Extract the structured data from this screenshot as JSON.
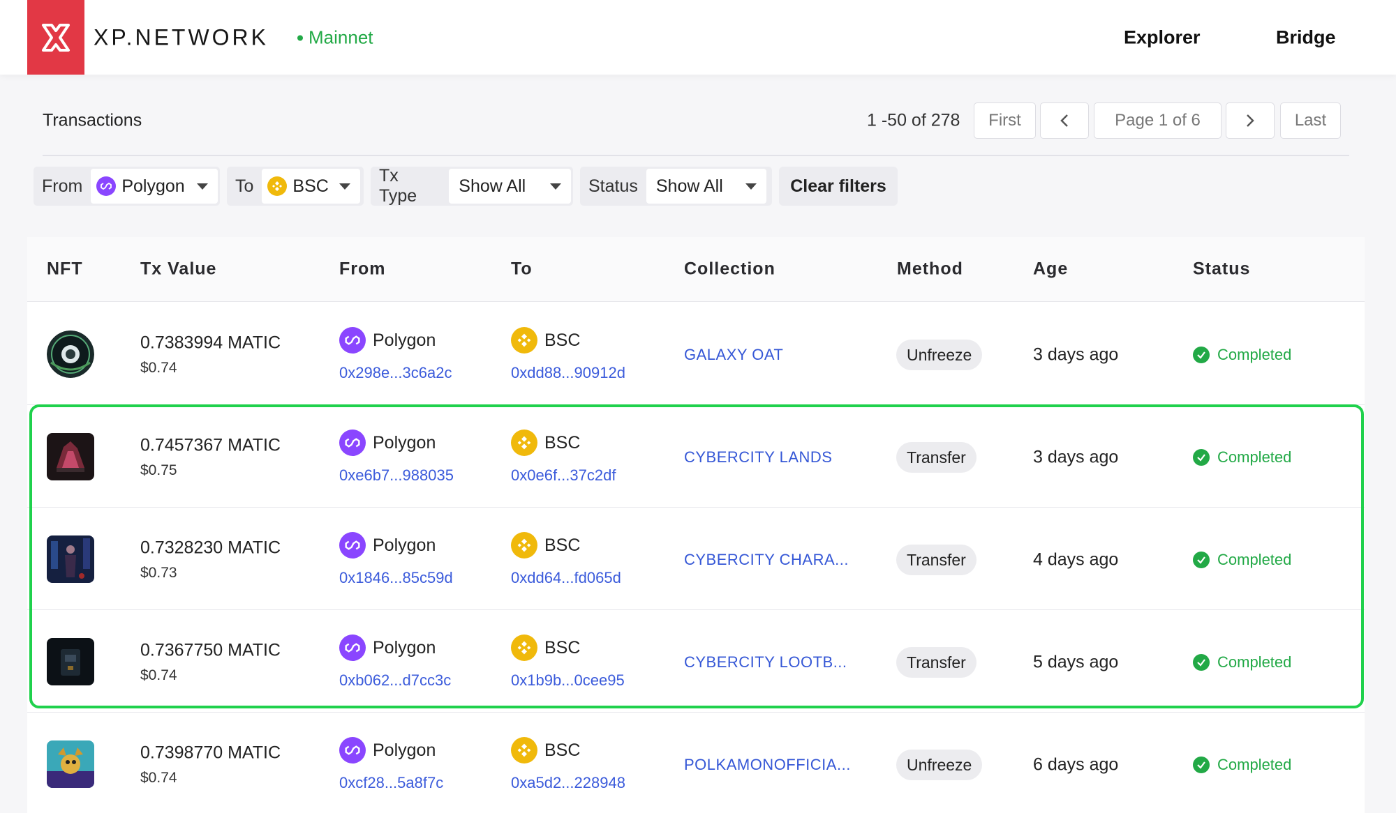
{
  "header": {
    "brand": "XP.NETWORK",
    "network": "Mainnet",
    "nav": [
      "Explorer",
      "Bridge"
    ],
    "accent": "#e23845",
    "network_color": "#22a946"
  },
  "toolbar": {
    "title": "Transactions",
    "range": "1 -50 of 278",
    "first": "First",
    "page": "Page 1 of 6",
    "last": "Last"
  },
  "filters": {
    "from_label": "From",
    "from_value": "Polygon",
    "to_label": "To",
    "to_value": "BSC",
    "txtype_label": "Tx Type",
    "txtype_value": "Show All",
    "status_label": "Status",
    "status_value": "Show All",
    "clear": "Clear filters"
  },
  "table": {
    "columns": [
      "NFT",
      "Tx Value",
      "From",
      "To",
      "Collection",
      "Method",
      "Age",
      "Status"
    ],
    "rows": [
      {
        "value": "0.7383994 MATIC",
        "usd": "$0.74",
        "from_chain": "Polygon",
        "from_addr": "0x298e...3c6a2c",
        "to_chain": "BSC",
        "to_addr": "0xdd88...90912d",
        "collection": "GALAXY OAT",
        "method": "Unfreeze",
        "age": "3 days ago",
        "status": "Completed"
      },
      {
        "value": "0.7457367 MATIC",
        "usd": "$0.75",
        "from_chain": "Polygon",
        "from_addr": "0xe6b7...988035",
        "to_chain": "BSC",
        "to_addr": "0x0e6f...37c2df",
        "collection": "CYBERCITY LANDS",
        "method": "Transfer",
        "age": "3 days ago",
        "status": "Completed"
      },
      {
        "value": "0.7328230 MATIC",
        "usd": "$0.73",
        "from_chain": "Polygon",
        "from_addr": "0x1846...85c59d",
        "to_chain": "BSC",
        "to_addr": "0xdd64...fd065d",
        "collection": "CYBERCITY CHARA...",
        "method": "Transfer",
        "age": "4 days ago",
        "status": "Completed"
      },
      {
        "value": "0.7367750 MATIC",
        "usd": "$0.74",
        "from_chain": "Polygon",
        "from_addr": "0xb062...d7cc3c",
        "to_chain": "BSC",
        "to_addr": "0x1b9b...0cee95",
        "collection": "CYBERCITY LOOTB...",
        "method": "Transfer",
        "age": "5 days ago",
        "status": "Completed"
      },
      {
        "value": "0.7398770 MATIC",
        "usd": "$0.74",
        "from_chain": "Polygon",
        "from_addr": "0xcf28...5a8f7c",
        "to_chain": "BSC",
        "to_addr": "0xa5d2...228948",
        "collection": "POLKAMONOFFICIA...",
        "method": "Unfreeze",
        "age": "6 days ago",
        "status": "Completed"
      }
    ]
  },
  "colors": {
    "polygon": "#8a46ff",
    "bsc": "#f0b90b",
    "link": "#3557d6",
    "completed": "#22a946",
    "highlight": "#1fd14c"
  }
}
